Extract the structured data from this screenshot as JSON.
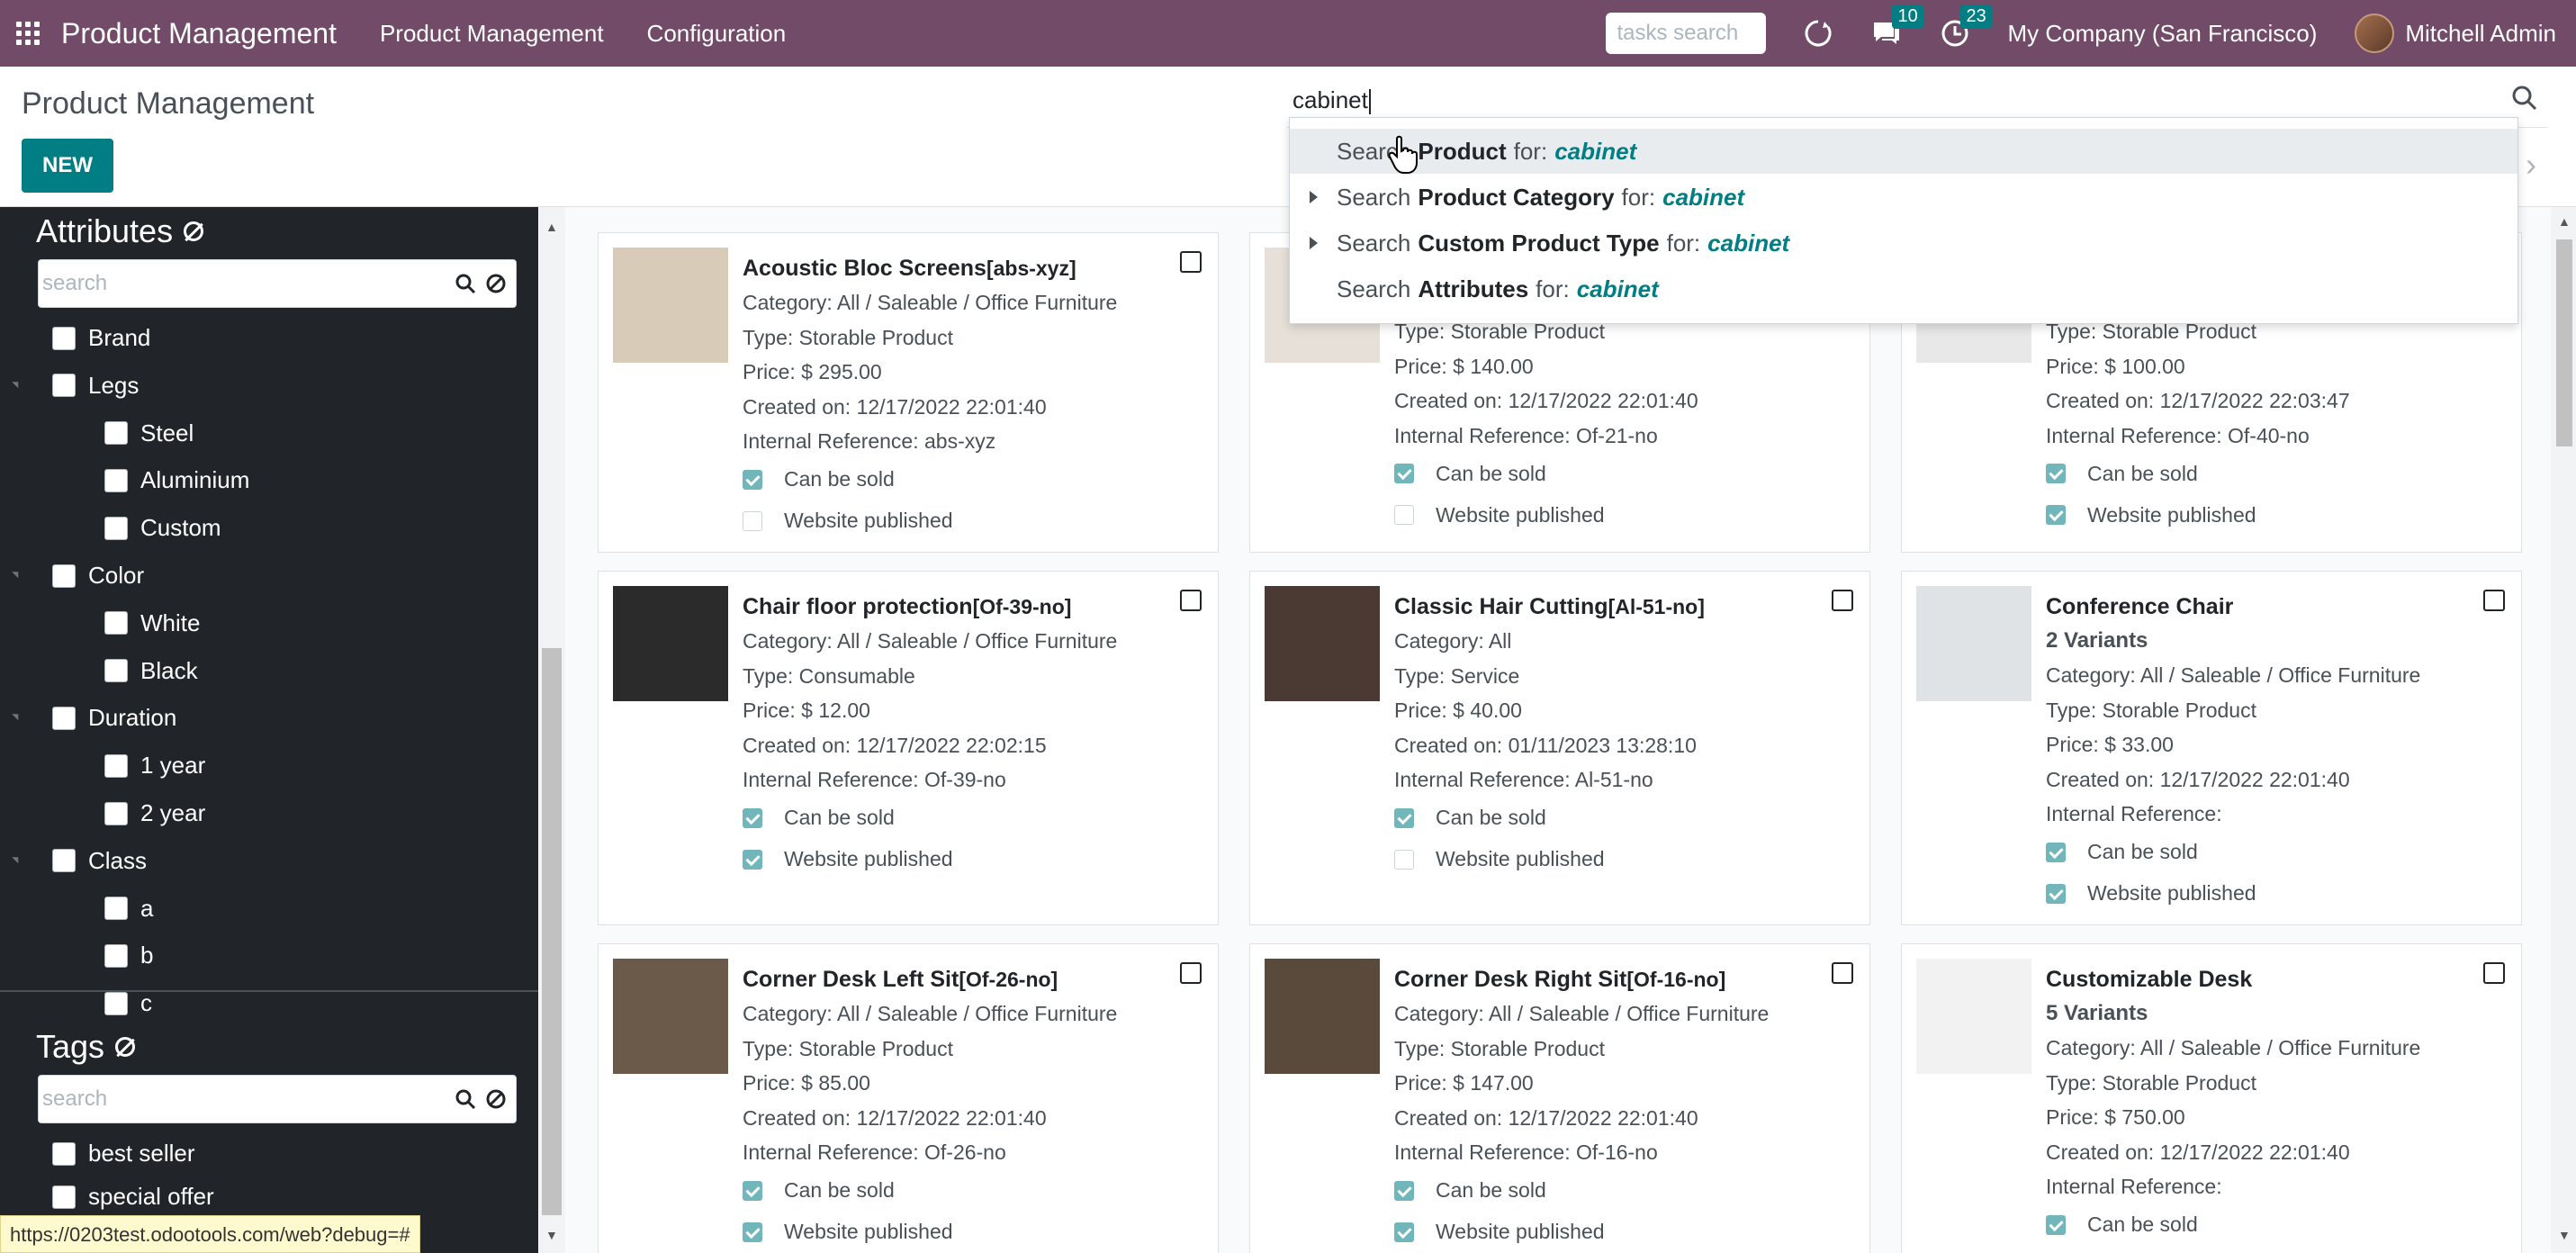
{
  "topnav": {
    "brand": "Product Management",
    "menu": [
      "Product Management",
      "Configuration"
    ],
    "tasks_search_placeholder": "tasks search",
    "messages_count": "10",
    "activities_count": "23",
    "company": "My Company (San Francisco)",
    "user": "Mitchell Admin",
    "icons": [
      "apps-grid-icon",
      "refresh-icon",
      "chat-icon",
      "clock-icon"
    ]
  },
  "control": {
    "title": "Product Management",
    "new_label": "NEW",
    "search_value": "cabinet"
  },
  "dropdown": {
    "items": [
      {
        "prefix": "Search",
        "field": "Product",
        "for": "for:",
        "term": "cabinet",
        "expandable": false
      },
      {
        "prefix": "Search",
        "field": "Product Category",
        "for": "for:",
        "term": "cabinet",
        "expandable": true
      },
      {
        "prefix": "Search",
        "field": "Custom Product Type",
        "for": "for:",
        "term": "cabinet",
        "expandable": true
      },
      {
        "prefix": "Search",
        "field": "Attributes",
        "for": "for:",
        "term": "cabinet",
        "expandable": false
      }
    ]
  },
  "sidebar": {
    "attributes": {
      "title": "Attributes",
      "search_placeholder": "search",
      "items": [
        {
          "label": "Brand",
          "level": 0
        },
        {
          "label": "Legs",
          "level": 0
        },
        {
          "label": "Steel",
          "level": 1
        },
        {
          "label": "Aluminium",
          "level": 1
        },
        {
          "label": "Custom",
          "level": 1
        },
        {
          "label": "Color",
          "level": 0
        },
        {
          "label": "White",
          "level": 1
        },
        {
          "label": "Black",
          "level": 1
        },
        {
          "label": "Duration",
          "level": 0
        },
        {
          "label": "1 year",
          "level": 1
        },
        {
          "label": "2 year",
          "level": 1
        },
        {
          "label": "Class",
          "level": 0
        },
        {
          "label": "a",
          "level": 1
        },
        {
          "label": "b",
          "level": 1
        },
        {
          "label": "c",
          "level": 1
        }
      ]
    },
    "tags": {
      "title": "Tags",
      "search_placeholder": "search",
      "items": [
        {
          "label": "best seller"
        },
        {
          "label": "special offer"
        }
      ]
    }
  },
  "status_url": "https://0203test.odootools.com/web?debug=#",
  "products": [
    {
      "name": "Acoustic Bloc Screens",
      "ref": "[abs-xyz]",
      "variants": "",
      "category": "Category: All / Saleable / Office Furniture",
      "type": "Type: Storable Product",
      "price": "Price: $ 295.00",
      "created": "Created on: 12/17/2022 22:01:40",
      "internal_ref": "Internal Reference: abs-xyz",
      "can_be_sold_label": "Can be sold",
      "can_be_sold": true,
      "published_label": "Website published",
      "published": false
    },
    {
      "name": "",
      "ref": "",
      "variants": "",
      "category": "",
      "type": "Type: Storable Product",
      "price": "Price: $ 140.00",
      "created": "Created on: 12/17/2022 22:01:40",
      "internal_ref": "Internal Reference: Of-21-no",
      "can_be_sold_label": "Can be sold",
      "can_be_sold": true,
      "published_label": "Website published",
      "published": false
    },
    {
      "name": "",
      "ref": "",
      "variants": "",
      "category": "",
      "type": "Type: Storable Product",
      "price": "Price: $ 100.00",
      "created": "Created on: 12/17/2022 22:03:47",
      "internal_ref": "Internal Reference: Of-40-no",
      "can_be_sold_label": "Can be sold",
      "can_be_sold": true,
      "published_label": "Website published",
      "published": true
    },
    {
      "name": "Chair floor protection",
      "ref": "[Of-39-no]",
      "variants": "",
      "category": "Category: All / Saleable / Office Furniture",
      "type": "Type: Consumable",
      "price": "Price: $ 12.00",
      "created": "Created on: 12/17/2022 22:02:15",
      "internal_ref": "Internal Reference: Of-39-no",
      "can_be_sold_label": "Can be sold",
      "can_be_sold": true,
      "published_label": "Website published",
      "published": true
    },
    {
      "name": "Classic Hair Cutting",
      "ref": "[Al-51-no]",
      "variants": "",
      "category": "Category: All",
      "type": "Type: Service",
      "price": "Price: $ 40.00",
      "created": "Created on: 01/11/2023 13:28:10",
      "internal_ref": "Internal Reference: Al-51-no",
      "can_be_sold_label": "Can be sold",
      "can_be_sold": true,
      "published_label": "Website published",
      "published": false
    },
    {
      "name": "Conference Chair",
      "ref": "",
      "variants": "2 Variants",
      "category": "Category: All / Saleable / Office Furniture",
      "type": "Type: Storable Product",
      "price": "Price: $ 33.00",
      "created": "Created on: 12/17/2022 22:01:40",
      "internal_ref": "Internal Reference:",
      "can_be_sold_label": "Can be sold",
      "can_be_sold": true,
      "published_label": "Website published",
      "published": true
    },
    {
      "name": "Corner Desk Left Sit",
      "ref": "[Of-26-no]",
      "variants": "",
      "category": "Category: All / Saleable / Office Furniture",
      "type": "Type: Storable Product",
      "price": "Price: $ 85.00",
      "created": "Created on: 12/17/2022 22:01:40",
      "internal_ref": "Internal Reference: Of-26-no",
      "can_be_sold_label": "Can be sold",
      "can_be_sold": true,
      "published_label": "Website published",
      "published": true
    },
    {
      "name": "Corner Desk Right Sit",
      "ref": "[Of-16-no]",
      "variants": "",
      "category": "Category: All / Saleable / Office Furniture",
      "type": "Type: Storable Product",
      "price": "Price: $ 147.00",
      "created": "Created on: 12/17/2022 22:01:40",
      "internal_ref": "Internal Reference: Of-16-no",
      "can_be_sold_label": "Can be sold",
      "can_be_sold": true,
      "published_label": "Website published",
      "published": true
    },
    {
      "name": "Customizable Desk",
      "ref": "",
      "variants": "5 Variants",
      "category": "Category: All / Saleable / Office Furniture",
      "type": "Type: Storable Product",
      "price": "Price: $ 750.00",
      "created": "Created on: 12/17/2022 22:01:40",
      "internal_ref": "Internal Reference:",
      "can_be_sold_label": "Can be sold",
      "can_be_sold": true,
      "published_label": "",
      "published": null
    }
  ],
  "colors": {
    "nav": "#714b67",
    "primary": "#017e84",
    "sidebar": "#212529",
    "check": "#71b6ba"
  }
}
